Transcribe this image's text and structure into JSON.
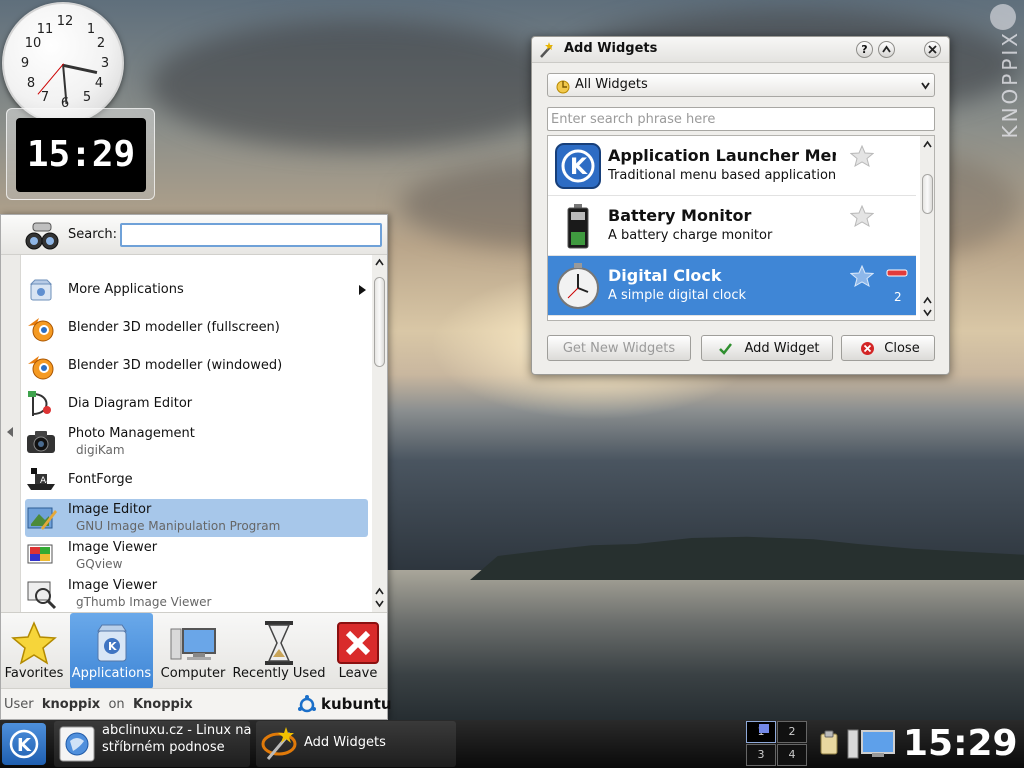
{
  "desktop": {
    "brand_text": "KNOPPIX",
    "analog_clock": {
      "numbers": [
        "12",
        "1",
        "2",
        "3",
        "4",
        "5",
        "6",
        "7",
        "8",
        "9",
        "10",
        "11"
      ]
    },
    "digital_clock": {
      "time": "15:29"
    }
  },
  "kickoff": {
    "search_label": "Search:",
    "search_value": "",
    "items": [
      {
        "title": "More Applications",
        "subtitle": "",
        "icon": "more-applications-icon",
        "submenu": true
      },
      {
        "title": "Blender 3D modeller (fullscreen)",
        "subtitle": "",
        "icon": "blender-icon"
      },
      {
        "title": "Blender 3D modeller (windowed)",
        "subtitle": "",
        "icon": "blender-icon"
      },
      {
        "title": "Dia Diagram Editor",
        "subtitle": "",
        "icon": "dia-icon"
      },
      {
        "title": "Photo Management",
        "subtitle": "digiKam",
        "icon": "camera-icon"
      },
      {
        "title": "FontForge",
        "subtitle": "",
        "icon": "fontforge-icon"
      },
      {
        "title": "Image Editor",
        "subtitle": "GNU Image Manipulation Program",
        "icon": "gimp-icon",
        "selected": true
      },
      {
        "title": "Image Viewer",
        "subtitle": "GQview",
        "icon": "image-viewer-icon"
      },
      {
        "title": "Image Viewer",
        "subtitle": "gThumb Image Viewer",
        "icon": "gthumb-icon"
      }
    ],
    "tabs": [
      {
        "label": "Favorites",
        "icon": "star-icon"
      },
      {
        "label": "Applications",
        "icon": "applications-icon",
        "active": true
      },
      {
        "label": "Computer",
        "icon": "computer-icon"
      },
      {
        "label": "Recently Used",
        "icon": "hourglass-icon"
      },
      {
        "label": "Leave",
        "icon": "leave-icon"
      }
    ],
    "footer": {
      "user_label": "User",
      "user_name": "knoppix",
      "on_label": "on",
      "host_name": "Knoppix",
      "brand": "kubuntu"
    }
  },
  "add_widgets": {
    "title": "Add Widgets",
    "help_label": "?",
    "filter_value": "All Widgets",
    "search_placeholder": "Enter search phrase here",
    "widgets": [
      {
        "name": "Application Launcher Menu",
        "description": "Traditional menu based application launcher",
        "icon": "kde-launcher-icon",
        "count": ""
      },
      {
        "name": "Battery Monitor",
        "description": "A battery charge monitor",
        "icon": "battery-icon",
        "count": ""
      },
      {
        "name": "Digital Clock",
        "description": "A simple digital clock",
        "icon": "clock-icon",
        "count": "2",
        "selected": true
      }
    ],
    "buttons": {
      "get_new": "Get New Widgets",
      "add": "Add Widget",
      "close": "Close"
    }
  },
  "taskbar": {
    "tasks": [
      {
        "title": "abclinuxu.cz - Linux na stříbrném podnose",
        "icon": "konqueror-icon"
      },
      {
        "title": "Add Widgets",
        "icon": "add-widgets-icon"
      }
    ],
    "desktops": [
      "1",
      "2",
      "3",
      "4"
    ],
    "time": "15:29"
  },
  "colors": {
    "selection": "#3f86d6",
    "menu_selection": "#a7c7ea",
    "taskbar": "#111111"
  }
}
